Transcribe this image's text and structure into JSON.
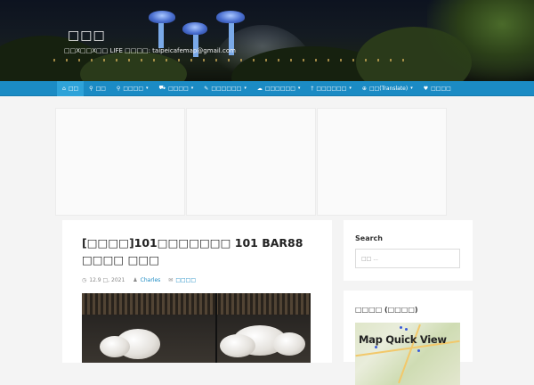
{
  "site": {
    "title": "□□□",
    "tagline": "□□X□□X□□ LIFE □□□□: taipeicafemap@gmail.com"
  },
  "nav": {
    "items": [
      {
        "icon": "home-icon",
        "glyph": "⌂",
        "label": "□□",
        "dropdown": false,
        "active": true
      },
      {
        "icon": "search-icon",
        "glyph": "⚲",
        "label": "□□",
        "dropdown": false,
        "active": false
      },
      {
        "icon": "location-pin-icon",
        "glyph": "⚲",
        "label": "□□□□",
        "dropdown": true,
        "active": false
      },
      {
        "icon": "car-icon",
        "glyph": "⛟",
        "label": "□□□□",
        "dropdown": true,
        "active": false
      },
      {
        "icon": "pencil-icon",
        "glyph": "✎",
        "label": "□□□□□□",
        "dropdown": true,
        "active": false
      },
      {
        "icon": "cloud-icon",
        "glyph": "☁",
        "label": "□□□□□□",
        "dropdown": true,
        "active": false
      },
      {
        "icon": "pin-icon",
        "glyph": "†",
        "label": "□□□□□□",
        "dropdown": true,
        "active": false
      },
      {
        "icon": "globe-icon",
        "glyph": "⊕",
        "label": "□□(Translate)",
        "dropdown": true,
        "active": false
      },
      {
        "icon": "heart-icon",
        "glyph": "♥",
        "label": "□□□□",
        "dropdown": false,
        "active": false
      }
    ]
  },
  "post": {
    "title": "[□□□□]101□□□□□□□ 101 BAR88 □□□□ □□□",
    "date": "12.9 □, 2021",
    "author": "Charles",
    "category": "□□□□"
  },
  "sidebar": {
    "search": {
      "title": "Search",
      "placeholder": "□□ ..."
    },
    "map": {
      "title": "□□□□ (□□□□)",
      "thumb_text": "Map Quick View"
    }
  },
  "colors": {
    "nav": "#1b8bc4",
    "nav_active": "#2ea3d9",
    "link": "#1b8bc4"
  }
}
